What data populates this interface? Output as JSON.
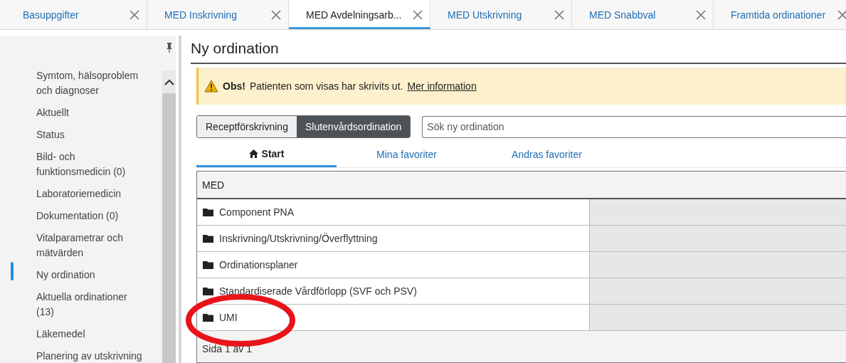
{
  "tabs": [
    {
      "label": "Basuppgifter",
      "selected": false
    },
    {
      "label": "MED Inskrivning",
      "selected": false
    },
    {
      "label": "MED Avdelningsarb...",
      "selected": true
    },
    {
      "label": "MED Utskrivning",
      "selected": false
    },
    {
      "label": "MED Snabbval",
      "selected": false
    },
    {
      "label": "Framtida ordinationer",
      "selected": false
    }
  ],
  "sidebar": {
    "items": [
      {
        "label": "Symtom, hälsoproblem och diagnoser",
        "selected": false
      },
      {
        "label": "Aktuellt",
        "selected": false
      },
      {
        "label": "Status",
        "selected": false
      },
      {
        "label": "Bild- och funktionsmedicin (0)",
        "selected": false
      },
      {
        "label": "Laboratoriemedicin",
        "selected": false
      },
      {
        "label": "Dokumentation (0)",
        "selected": false
      },
      {
        "label": "Vitalparametrar och mätvärden",
        "selected": false
      },
      {
        "label": "Ny ordination",
        "selected": true
      },
      {
        "label": "Aktuella ordinationer (13)",
        "selected": false
      },
      {
        "label": "Läkemedel",
        "selected": false
      },
      {
        "label": "Planering av utskrivning",
        "selected": false
      }
    ]
  },
  "page": {
    "title": "Ny ordination",
    "alert": {
      "title": "Obs!",
      "text": "Patienten som visas har skrivits ut.",
      "link": "Mer information"
    },
    "mode_switch": [
      {
        "label": "Receptförskrivning",
        "selected": false
      },
      {
        "label": "Slutenvårdsordination",
        "selected": true
      }
    ],
    "search": {
      "placeholder": "Sök ny ordination"
    },
    "subtabs": [
      {
        "label": "Start",
        "kind": "home",
        "selected": true
      },
      {
        "label": "Mina favoriter",
        "kind": "plain",
        "selected": false
      },
      {
        "label": "Andras favoriter",
        "kind": "plain",
        "selected": false
      }
    ],
    "table": {
      "header": "MED",
      "rows": [
        {
          "label": "Component PNA",
          "highlighted": false
        },
        {
          "label": "Inskrivning/Utskrivning/Överflyttning",
          "highlighted": false
        },
        {
          "label": "Ordinationsplaner",
          "highlighted": false
        },
        {
          "label": "Standardiserade Vårdförlopp (SVF och PSV)",
          "highlighted": false
        },
        {
          "label": "UMI",
          "highlighted": true
        }
      ],
      "footer": "Sida 1 av 1"
    }
  }
}
